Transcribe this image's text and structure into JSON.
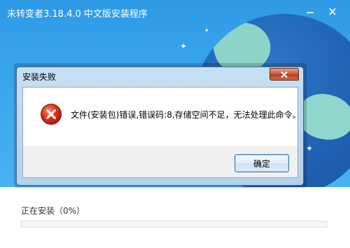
{
  "installer": {
    "title": "未转变者3.18.4.0 中文版安装程序",
    "progress_label": "正在安装（0%）",
    "progress_fraction": 0,
    "accent_color": "#3aa0ea"
  },
  "icons": {
    "minimize": "minimize-icon",
    "close": "close-icon",
    "dialog_close": "close-icon",
    "error": "error-icon"
  },
  "dialog": {
    "title": "安装失败",
    "message": "文件(安装包)错误,错误码:8,存储空间不足，无法处理此命令。",
    "ok_label": "确定"
  }
}
